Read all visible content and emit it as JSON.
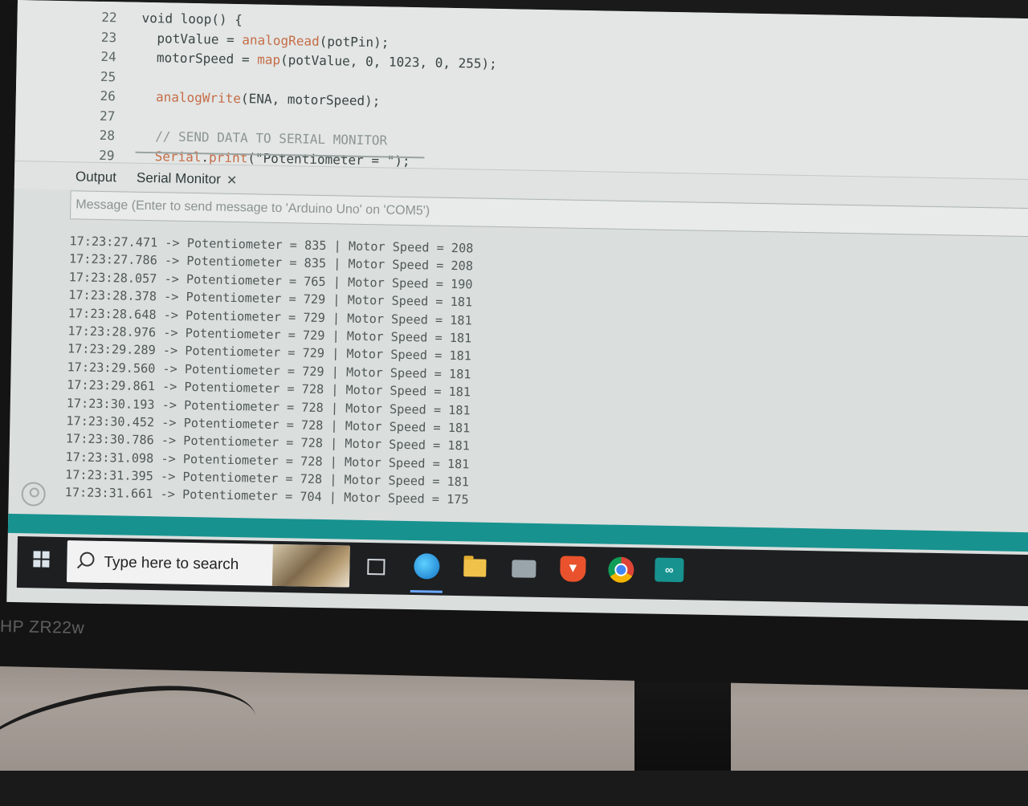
{
  "editor": {
    "line_numbers": [
      "22",
      "23",
      "24",
      "25",
      "26",
      "27",
      "28",
      "29"
    ],
    "code": [
      {
        "parts": [
          {
            "t": "void loop() {",
            "c": ""
          }
        ]
      },
      {
        "parts": [
          {
            "t": "  potValue = ",
            "c": ""
          },
          {
            "t": "analogRead",
            "c": "fn"
          },
          {
            "t": "(potPin);",
            "c": ""
          }
        ]
      },
      {
        "parts": [
          {
            "t": "  motorSpeed = ",
            "c": ""
          },
          {
            "t": "map",
            "c": "fn"
          },
          {
            "t": "(potValue, 0, 1023, 0, 255);",
            "c": ""
          }
        ]
      },
      {
        "parts": [
          {
            "t": "",
            "c": ""
          }
        ]
      },
      {
        "parts": [
          {
            "t": "  ",
            "c": ""
          },
          {
            "t": "analogWrite",
            "c": "fn"
          },
          {
            "t": "(ENA, motorSpeed);",
            "c": ""
          }
        ]
      },
      {
        "parts": [
          {
            "t": "",
            "c": ""
          }
        ]
      },
      {
        "parts": [
          {
            "t": "  // SEND DATA TO SERIAL MONITOR",
            "c": "comment"
          }
        ]
      },
      {
        "parts": [
          {
            "t": "  ",
            "c": ""
          },
          {
            "t": "Serial",
            "c": "fn"
          },
          {
            "t": ".",
            "c": ""
          },
          {
            "t": "print",
            "c": "fn"
          },
          {
            "t": "(\"Potentiometer = \");",
            "c": ""
          }
        ]
      }
    ]
  },
  "panel_tabs": {
    "output_label": "Output",
    "serial_label": "Serial Monitor",
    "close_symbol": "✕"
  },
  "message_input": {
    "placeholder": "Message (Enter to send message to 'Arduino Uno' on 'COM5')"
  },
  "serial_output": [
    "17:23:27.471 -> Potentiometer = 835 | Motor Speed = 208",
    "17:23:27.786 -> Potentiometer = 835 | Motor Speed = 208",
    "17:23:28.057 -> Potentiometer = 765 | Motor Speed = 190",
    "17:23:28.378 -> Potentiometer = 729 | Motor Speed = 181",
    "17:23:28.648 -> Potentiometer = 729 | Motor Speed = 181",
    "17:23:28.976 -> Potentiometer = 729 | Motor Speed = 181",
    "17:23:29.289 -> Potentiometer = 729 | Motor Speed = 181",
    "17:23:29.560 -> Potentiometer = 729 | Motor Speed = 181",
    "17:23:29.861 -> Potentiometer = 728 | Motor Speed = 181",
    "17:23:30.193 -> Potentiometer = 728 | Motor Speed = 181",
    "17:23:30.452 -> Potentiometer = 728 | Motor Speed = 181",
    "17:23:30.786 -> Potentiometer = 728 | Motor Speed = 181",
    "17:23:31.098 -> Potentiometer = 728 | Motor Speed = 181",
    "17:23:31.395 -> Potentiometer = 728 | Motor Speed = 181",
    "17:23:31.661 -> Potentiometer = 704 | Motor Speed = 175"
  ],
  "taskbar": {
    "search_placeholder": "Type here to search",
    "icons": [
      "windows-start-icon",
      "task-view-icon",
      "edge-icon",
      "file-explorer-icon",
      "app-icon",
      "brave-icon",
      "chrome-icon",
      "arduino-ide-icon"
    ]
  },
  "monitor": {
    "brand_label": "HP ZR22w"
  },
  "colors": {
    "accent_teal": "#17928f",
    "code_function": "#c66d48",
    "comment": "#8d9694",
    "screen_bg": "#dadedd"
  }
}
